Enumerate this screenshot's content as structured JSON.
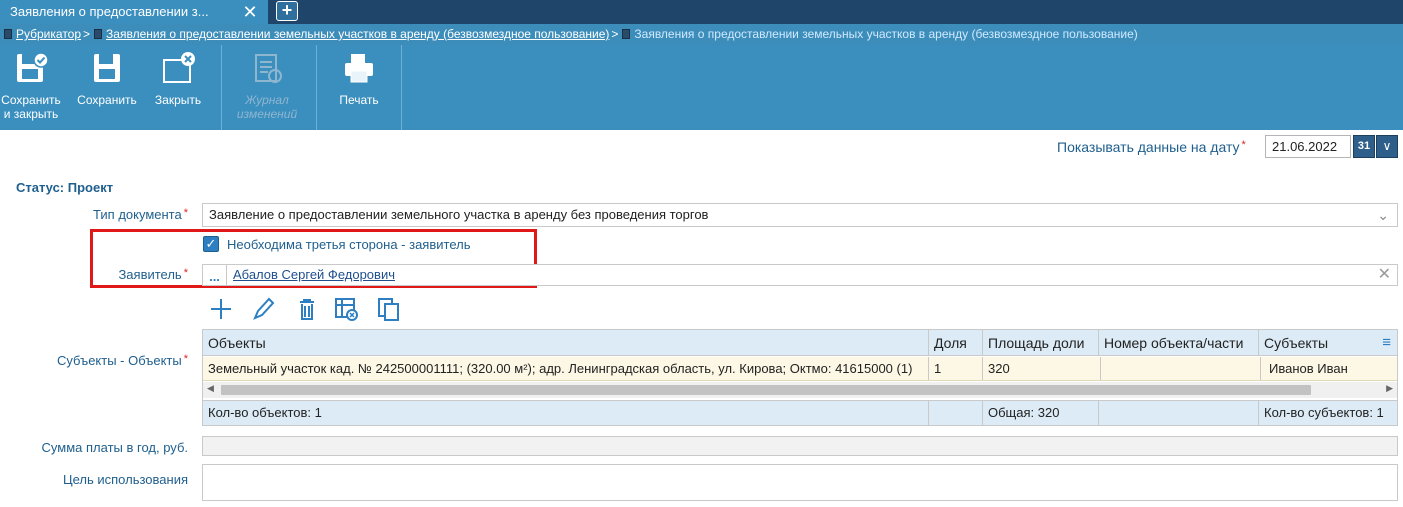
{
  "tabs": {
    "active_label": "Заявления о предоставлении з...",
    "close_glyph": "✕",
    "add_glyph": "+"
  },
  "breadcrumb": {
    "root": "Рубрикатор",
    "section": "Заявления о предоставлении земельных участков в аренду (безвозмездное пользование)",
    "current": "Заявления о предоставлении земельных участков в аренду (безвозмездное пользование)",
    "separator": ">"
  },
  "toolbar": {
    "save_close": "Сохранить и закрыть",
    "save": "Сохранить",
    "close": "Закрыть",
    "journal": "Журнал изменений",
    "print": "Печать"
  },
  "date": {
    "label": "Показывать данные на дату",
    "value": "21.06.2022",
    "calendar_glyph": "31",
    "chevron_glyph": "∨"
  },
  "status": "Статус: Проект",
  "form": {
    "doc_type_label": "Тип документа",
    "doc_type_value": "Заявление о предоставлении земельного участка в аренду без проведения торгов",
    "third_party_label": "Необходима третья сторона - заявитель",
    "third_party_checked": true,
    "applicant_label": "Заявитель",
    "applicant_value": "Абалов Сергей Федорович",
    "applicant_dots": "...",
    "subjects_objects_label": "Субъекты - Объекты",
    "annual_payment_label": "Сумма платы в год, руб.",
    "annual_payment_value": "",
    "purpose_label": "Цель использования",
    "purpose_value": "",
    "required_mark": "*"
  },
  "grid": {
    "columns": [
      "Объекты",
      "Доля",
      "Площадь доли",
      "Номер объекта/части",
      "Субъекты"
    ],
    "rows": [
      {
        "object": "Земельный участок кад. № 242500001111; (320.00 м²); адр. Ленинградская область, ул. Кирова; Октмо: 41615000 (1)",
        "share": "1",
        "area": "320",
        "part_number": "",
        "subject": "Иванов Иван"
      }
    ],
    "footer": {
      "objects_count": "Кол-во объектов: 1",
      "total": "Общая: 320",
      "subjects_count": "Кол-во субъектов: 1"
    },
    "menu_glyph": "≡"
  },
  "colors": {
    "accent": "#3a8fbf",
    "label": "#1f5f8e",
    "required": "#dd2222",
    "highlight_box": "#e01818",
    "row_highlight": "#fdf8e5"
  }
}
